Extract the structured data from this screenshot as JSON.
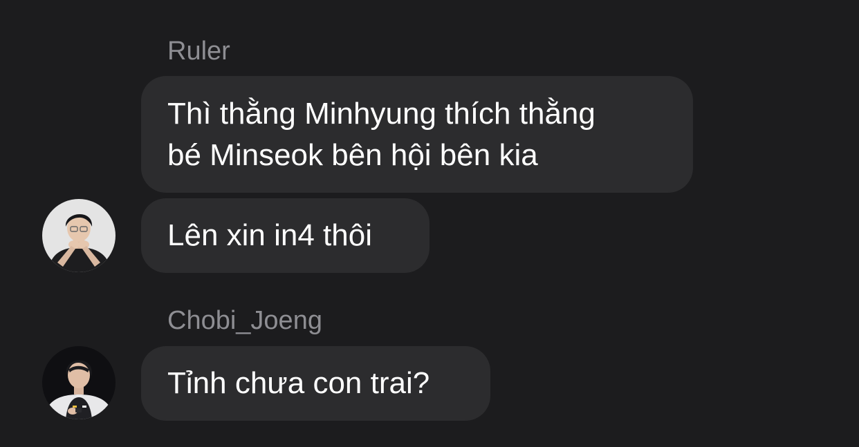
{
  "groups": [
    {
      "sender": "Ruler",
      "messages": [
        {
          "lines": [
            "Thì thằng Minhyung thích thằng",
            "bé Minseok bên hội bên kia"
          ]
        },
        {
          "lines": [
            "Lên xin in4 thôi"
          ]
        }
      ],
      "avatar_icon": "user-avatar-ruler"
    },
    {
      "sender": "Chobi_Joeng",
      "messages": [
        {
          "lines": [
            "Tỉnh chưa con trai?"
          ]
        }
      ],
      "avatar_icon": "user-avatar-chobi"
    }
  ],
  "colors": {
    "background": "#1c1c1e",
    "bubble": "#2c2c2e",
    "sender_name": "#8e8e93",
    "message_text": "#ffffff"
  }
}
